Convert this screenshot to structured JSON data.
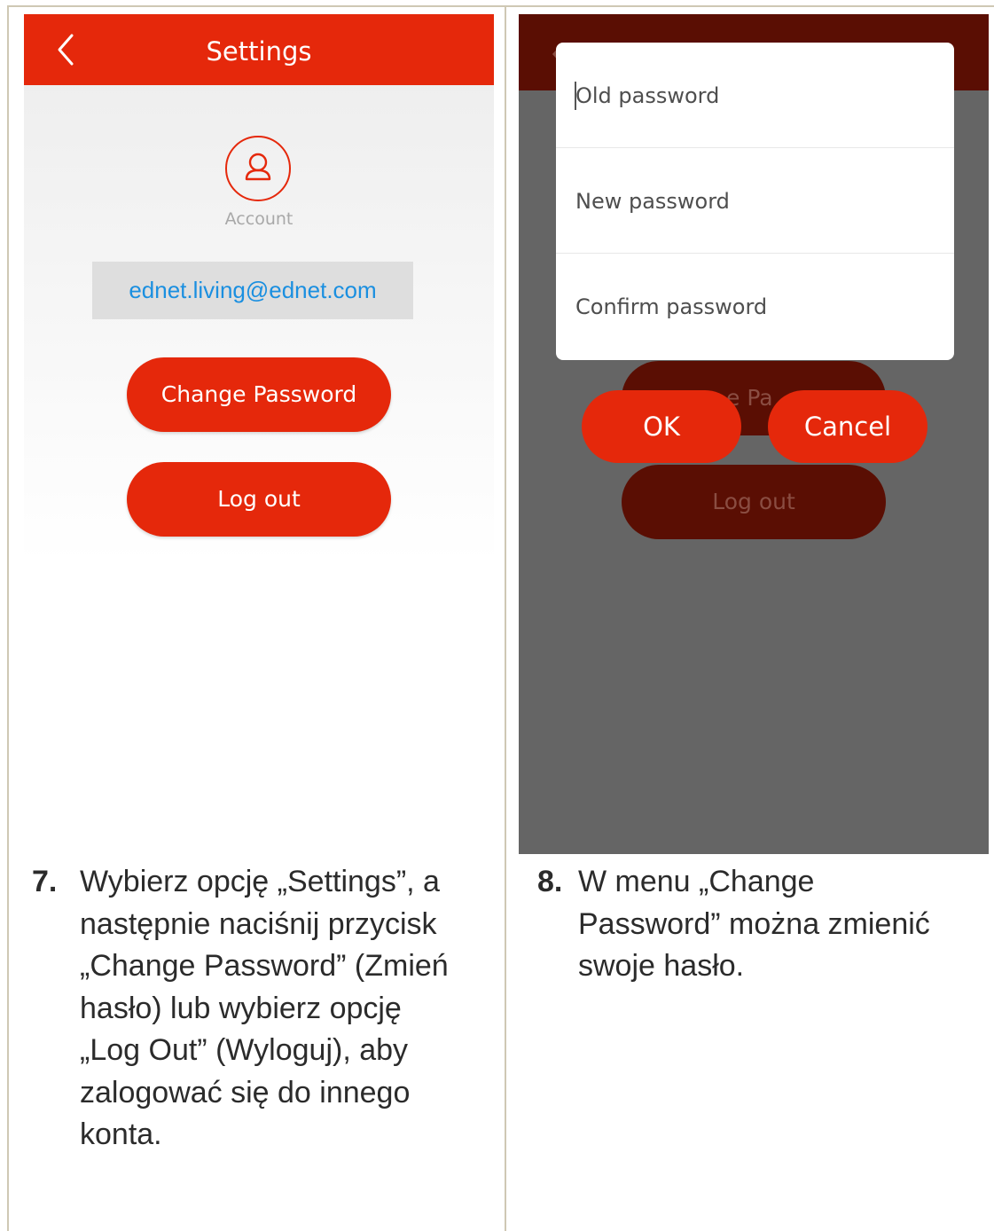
{
  "left_screen": {
    "title": "Settings",
    "account_label": "Account",
    "email": "ednet.living@ednet.com",
    "change_password_label": "Change Password",
    "logout_label": "Log out",
    "colors": {
      "accent": "#e5280b",
      "email_text": "#1a8fe0"
    },
    "icons": [
      "chevron-left-icon",
      "user-account-icon"
    ]
  },
  "right_screen": {
    "dialog": {
      "old_password_placeholder": "Old password",
      "new_password_placeholder": "New password",
      "confirm_password_placeholder": "Confirm password",
      "ok_label": "OK",
      "cancel_label": "Cancel"
    },
    "background_logout_label": "Log out",
    "background_change_partial": "e Pa"
  },
  "captions": {
    "step7": {
      "number": "7.",
      "lines": [
        "Wybierz opcję „Settings”, a",
        "następnie naciśnij przycisk",
        "„Change Password” (Zmień",
        "hasło) lub wybierz opcję",
        "„Log Out” (Wyloguj), aby",
        "zalogować się do innego",
        "konta."
      ]
    },
    "step8": {
      "number": "8.",
      "lines": [
        "W menu „Change",
        "Password” można zmienić",
        "swoje hasło."
      ]
    }
  }
}
